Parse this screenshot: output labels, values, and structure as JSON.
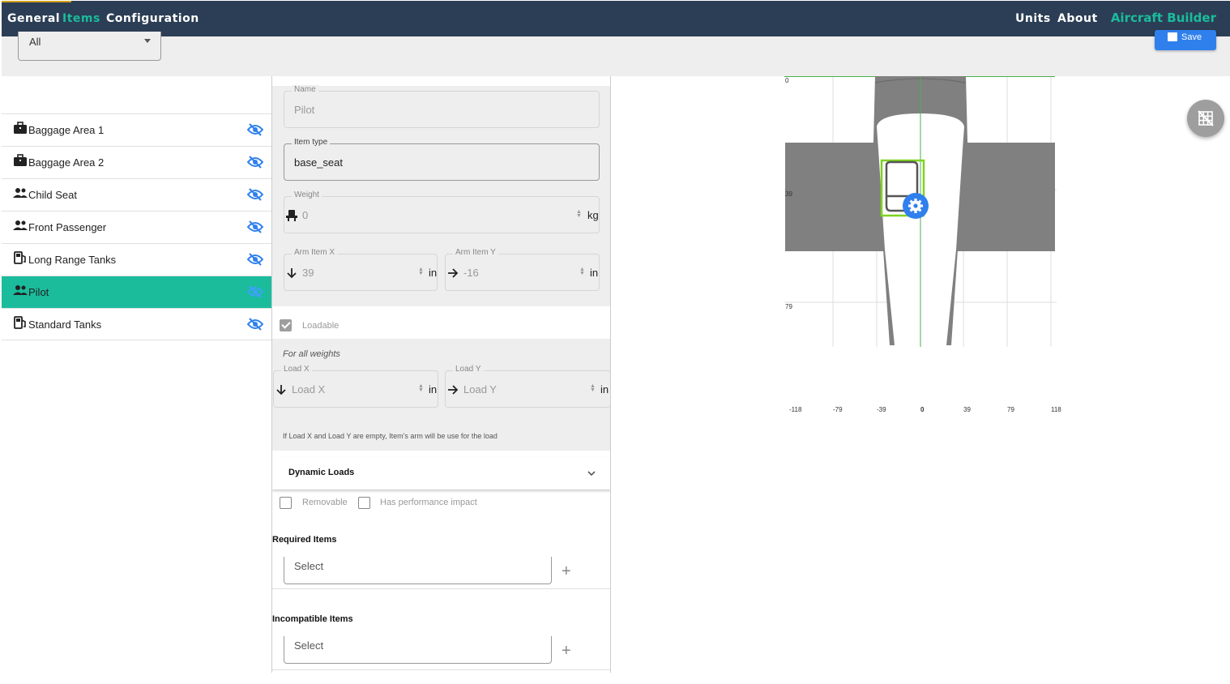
{
  "nav": {
    "left": [
      "General",
      "Items",
      "Configuration"
    ],
    "active": "Items",
    "right": [
      "Units",
      "About"
    ],
    "brand": "Aircraft Builder"
  },
  "filter": {
    "value": "All"
  },
  "toolbar": {
    "save_label": "Save"
  },
  "items": [
    {
      "label": "Baggage Area 1",
      "icon": "briefcase-icon",
      "visible": false
    },
    {
      "label": "Baggage Area 2",
      "icon": "briefcase-icon",
      "visible": false
    },
    {
      "label": "Child Seat",
      "icon": "people-icon",
      "visible": false
    },
    {
      "label": "Front Passenger",
      "icon": "people-icon",
      "visible": false
    },
    {
      "label": "Long Range Tanks",
      "icon": "fuel-icon",
      "visible": false
    },
    {
      "label": "Pilot",
      "icon": "people-icon",
      "visible": false,
      "selected": true
    },
    {
      "label": "Standard Tanks",
      "icon": "fuel-icon",
      "visible": false
    }
  ],
  "form": {
    "name": {
      "label": "Name",
      "value": "Pilot"
    },
    "item_type": {
      "label": "Item type",
      "value": "base_seat"
    },
    "weight": {
      "label": "Weight",
      "value": "0",
      "unit": "kg"
    },
    "arm_x": {
      "label": "Arm Item X",
      "value": "39",
      "unit": "in"
    },
    "arm_y": {
      "label": "Arm Item Y",
      "value": "-16",
      "unit": "in"
    },
    "loadable": {
      "label": "Loadable",
      "checked": true
    },
    "for_all_weights": "For all weights",
    "load_x": {
      "label": "Load X",
      "placeholder": "Load X",
      "unit": "in"
    },
    "load_y": {
      "label": "Load Y",
      "placeholder": "Load Y",
      "unit": "in"
    },
    "load_hint": "If Load X and Load Y are empty, Item's arm will be use for the load",
    "dynamic_loads": "Dynamic Loads",
    "removable": {
      "label": "Removable",
      "checked": false
    },
    "perf_impact": {
      "label": "Has performance impact",
      "checked": false
    },
    "required_items": {
      "title": "Required Items",
      "placeholder": "Select"
    },
    "incompatible_items": {
      "title": "Incompatible Items",
      "placeholder": "Select"
    }
  },
  "diagram": {
    "y_ticks": [
      "0",
      "39",
      "79"
    ],
    "x_ticks": [
      "-118",
      "-79",
      "-39",
      "0",
      "39",
      "79",
      "118"
    ],
    "colors": {
      "fuselage": "#808080",
      "selection": "#7ed321",
      "gear_button": "#2f80ed",
      "center_line": "#4caf50"
    }
  }
}
